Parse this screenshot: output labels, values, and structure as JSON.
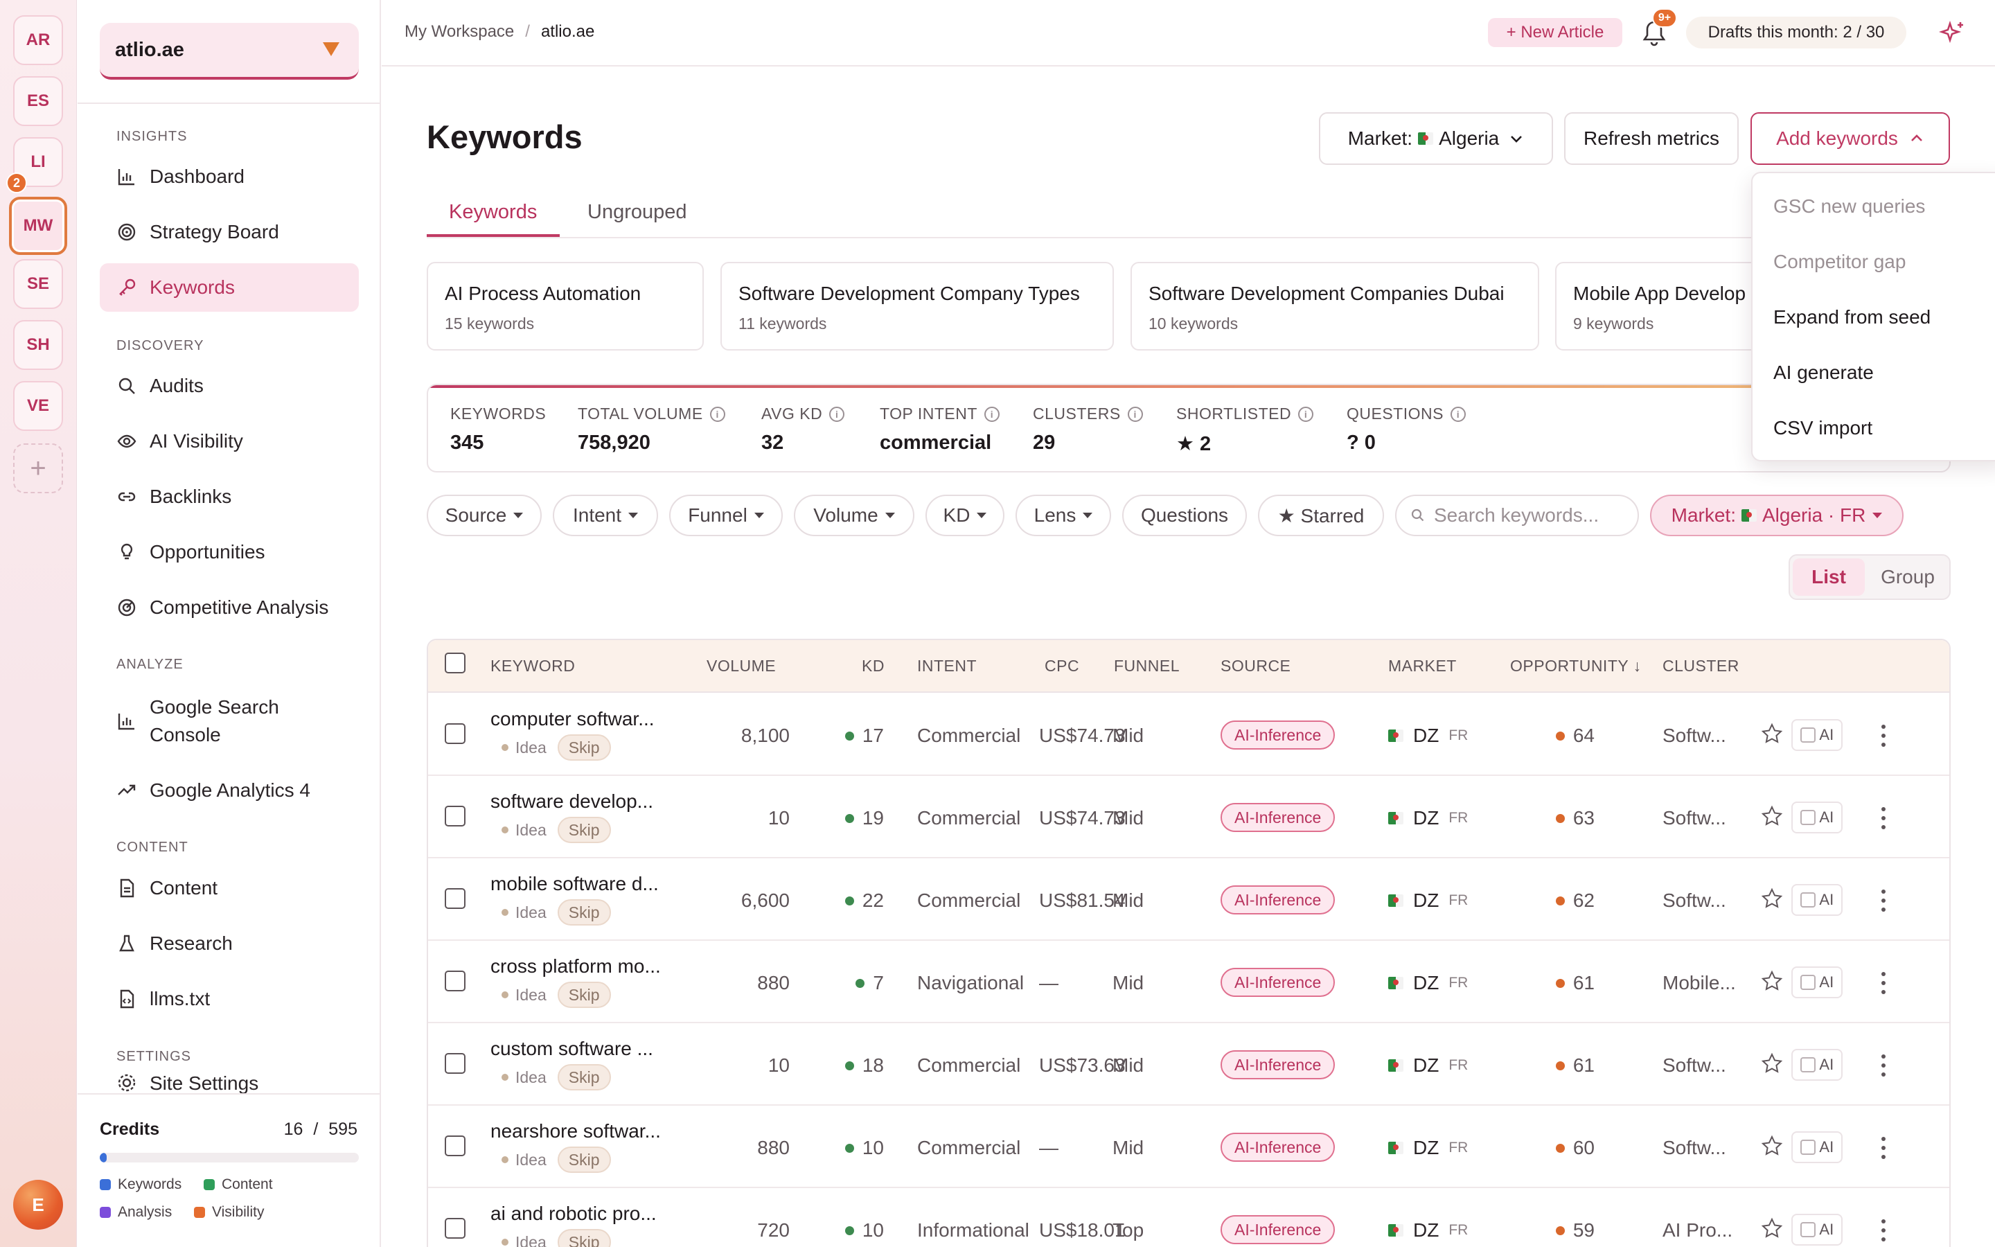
{
  "workspaces": {
    "items": [
      {
        "label": "AR"
      },
      {
        "label": "ES"
      },
      {
        "label": "LI"
      },
      {
        "label": "MW"
      },
      {
        "label": "SE"
      },
      {
        "label": "SH"
      },
      {
        "label": "VE"
      }
    ],
    "active_badge": "2",
    "user_initial": "E"
  },
  "sidebar": {
    "site": "atlio.ae",
    "sections": {
      "insights": "INSIGHTS",
      "discovery": "DISCOVERY",
      "analyze": "ANALYZE",
      "content": "CONTENT",
      "settings": "SETTINGS"
    },
    "items": {
      "dashboard": "Dashboard",
      "strategy": "Strategy Board",
      "keywords": "Keywords",
      "audits": "Audits",
      "ai_visibility": "AI Visibility",
      "backlinks": "Backlinks",
      "opportunities": "Opportunities",
      "competitive": "Competitive Analysis",
      "gsc": "Google Search Console",
      "ga4": "Google Analytics 4",
      "content": "Content",
      "research": "Research",
      "llms": "llms.txt",
      "site_settings": "Site Settings"
    },
    "credits": {
      "title": "Credits",
      "used": "16",
      "total": "/ 595",
      "fraction_used": 0.027,
      "legend": {
        "keywords": "Keywords",
        "content": "Content",
        "analysis": "Analysis",
        "visibility": "Visibility"
      },
      "colors": {
        "keywords": "#3b6fd8",
        "content": "#2f9e5a",
        "analysis": "#7c4ddb",
        "visibility": "#e56d2f"
      }
    }
  },
  "topbar": {
    "breadcrumb_root": "My Workspace",
    "breadcrumb_sep": "/",
    "breadcrumb_current": "atlio.ae",
    "new_article": "+ New Article",
    "notif_badge": "9+",
    "drafts": "Drafts this month: 2 / 30"
  },
  "page": {
    "title": "Keywords",
    "market_label": "Market:",
    "market_value": "Algeria",
    "refresh": "Refresh metrics",
    "add_keywords": "Add keywords",
    "tabs": {
      "keywords": "Keywords",
      "ungrouped": "Ungrouped"
    }
  },
  "dropdown": {
    "items": [
      "GSC new queries",
      "Competitor gap",
      "Expand from seed",
      "AI generate",
      "CSV import"
    ]
  },
  "clusters": [
    {
      "name": "AI Process Automation",
      "count": "15 keywords"
    },
    {
      "name": "Software Development Company Types",
      "count": "11 keywords"
    },
    {
      "name": "Software Development Companies Dubai",
      "count": "10 keywords"
    },
    {
      "name": "Mobile App Develop",
      "count": "9 keywords"
    }
  ],
  "stats": {
    "keywords": {
      "label": "KEYWORDS",
      "value": "345"
    },
    "volume": {
      "label": "TOTAL VOLUME",
      "value": "758,920"
    },
    "kd": {
      "label": "AVG KD",
      "value": "32"
    },
    "intent": {
      "label": "TOP INTENT",
      "value": "commercial"
    },
    "clusters": {
      "label": "CLUSTERS",
      "value": "29"
    },
    "shortlisted": {
      "label": "SHORTLISTED",
      "value": "★ 2"
    },
    "questions": {
      "label": "QUESTIONS",
      "value": "? 0"
    }
  },
  "filters": {
    "source": "Source",
    "intent": "Intent",
    "funnel": "Funnel",
    "volume": "Volume",
    "kd": "KD",
    "lens": "Lens",
    "questions": "Questions",
    "starred": "★ Starred",
    "search_placeholder": "Search keywords...",
    "market_prefix": "Market:",
    "market_value": "Algeria · FR"
  },
  "view_toggle": {
    "list": "List",
    "group": "Group"
  },
  "table": {
    "headers": {
      "keyword": "KEYWORD",
      "volume": "VOLUME",
      "kd": "KD",
      "intent": "INTENT",
      "cpc": "CPC",
      "funnel": "FUNNEL",
      "source": "SOURCE",
      "market": "MARKET",
      "opportunity": "OPPORTUNITY ↓",
      "cluster": "CLUSTER"
    },
    "rows": [
      {
        "keyword": "computer softwar...",
        "status": "Idea",
        "skip": "Skip",
        "volume": "8,100",
        "kd": "17",
        "intent": "Commercial",
        "cpc": "US$74.73",
        "funnel": "Mid",
        "source": "AI-Inference",
        "market": "DZ",
        "lang": "FR",
        "opportunity": "64",
        "cluster": "Softw...",
        "ai": "AI"
      },
      {
        "keyword": "software develop...",
        "status": "Idea",
        "skip": "Skip",
        "volume": "10",
        "kd": "19",
        "intent": "Commercial",
        "cpc": "US$74.73",
        "funnel": "Mid",
        "source": "AI-Inference",
        "market": "DZ",
        "lang": "FR",
        "opportunity": "63",
        "cluster": "Softw...",
        "ai": "AI"
      },
      {
        "keyword": "mobile software d...",
        "status": "Idea",
        "skip": "Skip",
        "volume": "6,600",
        "kd": "22",
        "intent": "Commercial",
        "cpc": "US$81.54",
        "funnel": "Mid",
        "source": "AI-Inference",
        "market": "DZ",
        "lang": "FR",
        "opportunity": "62",
        "cluster": "Softw...",
        "ai": "AI"
      },
      {
        "keyword": "cross platform mo...",
        "status": "Idea",
        "skip": "Skip",
        "volume": "880",
        "kd": "7",
        "intent": "Navigational",
        "cpc": "—",
        "funnel": "Mid",
        "source": "AI-Inference",
        "market": "DZ",
        "lang": "FR",
        "opportunity": "61",
        "cluster": "Mobile...",
        "ai": "AI"
      },
      {
        "keyword": "custom software ...",
        "status": "Idea",
        "skip": "Skip",
        "volume": "10",
        "kd": "18",
        "intent": "Commercial",
        "cpc": "US$73.63",
        "funnel": "Mid",
        "source": "AI-Inference",
        "market": "DZ",
        "lang": "FR",
        "opportunity": "61",
        "cluster": "Softw...",
        "ai": "AI"
      },
      {
        "keyword": "nearshore softwar...",
        "status": "Idea",
        "skip": "Skip",
        "volume": "880",
        "kd": "10",
        "intent": "Commercial",
        "cpc": "—",
        "funnel": "Mid",
        "source": "AI-Inference",
        "market": "DZ",
        "lang": "FR",
        "opportunity": "60",
        "cluster": "Softw...",
        "ai": "AI"
      },
      {
        "keyword": "ai and robotic pro...",
        "status": "Idea",
        "skip": "Skip",
        "volume": "720",
        "kd": "10",
        "intent": "Informational",
        "cpc": "US$18.01",
        "funnel": "Top",
        "source": "AI-Inference",
        "market": "DZ",
        "lang": "FR",
        "opportunity": "59",
        "cluster": "AI Pro...",
        "ai": "AI"
      }
    ]
  },
  "colors": {
    "accent": "#c03a63",
    "kd_dot": "#3d8a4f",
    "opp_dot": "#d9672b"
  }
}
